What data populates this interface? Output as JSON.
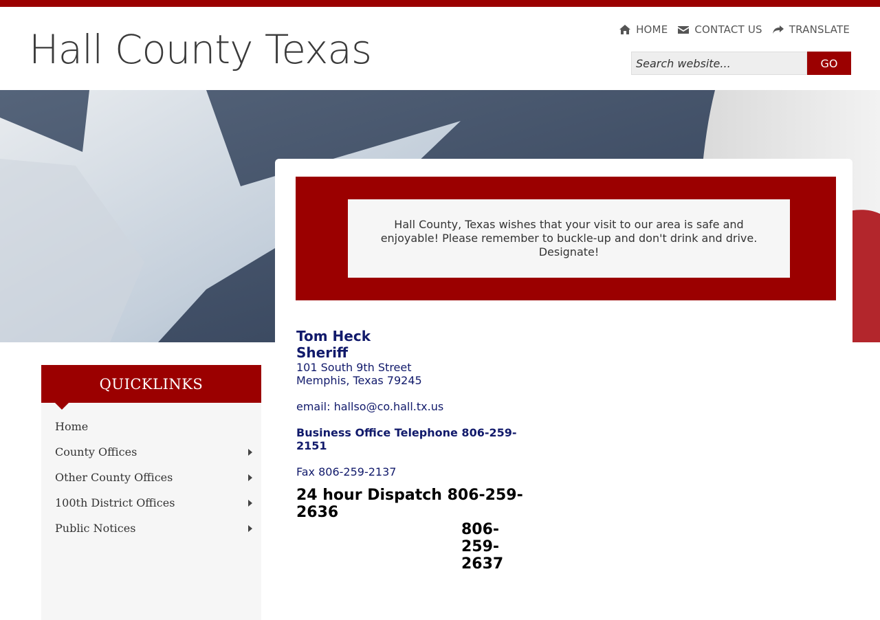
{
  "header": {
    "site_title": "Hall County Texas",
    "nav": [
      {
        "label": "HOME",
        "icon": "home-icon"
      },
      {
        "label": "CONTACT US",
        "icon": "envelope-icon"
      },
      {
        "label": "TRANSLATE",
        "icon": "share-arrow-icon"
      }
    ],
    "search": {
      "placeholder": "Search website...",
      "button_label": "GO"
    }
  },
  "notice": {
    "text": "Hall County, Texas wishes that your visit to our area is safe and enjoyable! Please remember to buckle-up and don't drink and drive. Designate!"
  },
  "contact": {
    "name": "Tom Heck",
    "role": "Sheriff",
    "address_line1": "101 South 9th Street",
    "address_line2": "Memphis, Texas 79245",
    "email": "email: hallso@co.hall.tx.us",
    "business_phone": "Business Office Telephone 806-259-2151",
    "fax": "Fax 806-259-2137",
    "dispatch": "24 hour Dispatch 806-259-2636",
    "dispatch_alt": "806-259-2637"
  },
  "quicklinks": {
    "title": "QUICKLINKS",
    "items": [
      {
        "label": "Home",
        "has_submenu": false
      },
      {
        "label": "County Offices",
        "has_submenu": true
      },
      {
        "label": "Other County Offices",
        "has_submenu": true
      },
      {
        "label": "100th District Offices",
        "has_submenu": true
      },
      {
        "label": "Public Notices",
        "has_submenu": true
      }
    ]
  },
  "colors": {
    "brand_red": "#9b0000",
    "contact_blue": "#111a6b"
  }
}
